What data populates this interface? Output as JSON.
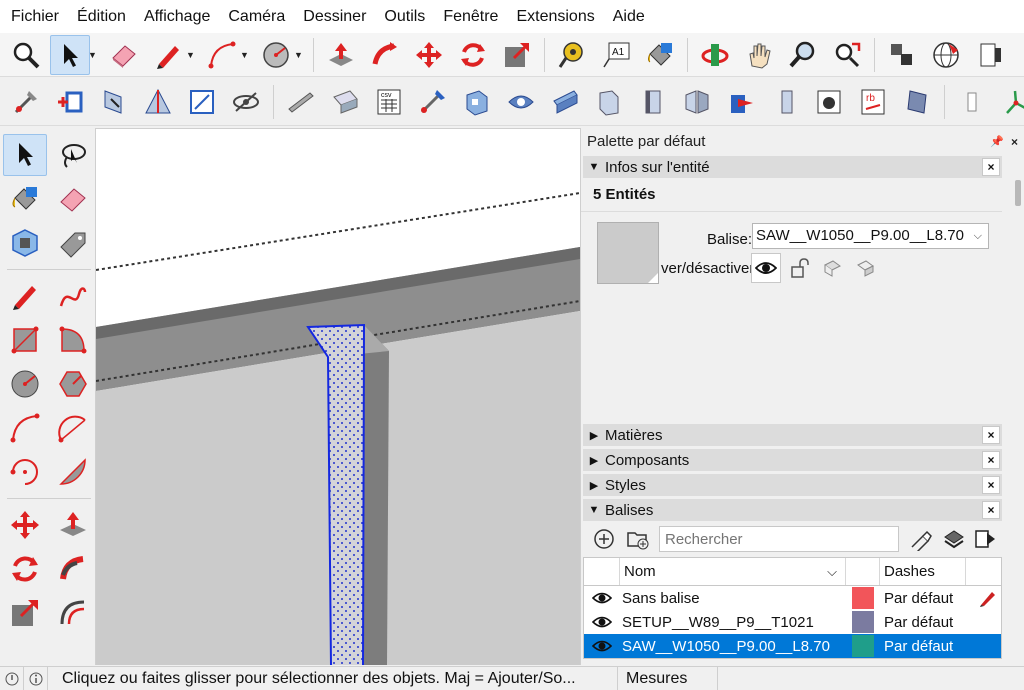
{
  "menu": [
    "Fichier",
    "Édition",
    "Affichage",
    "Caméra",
    "Dessiner",
    "Outils",
    "Fenêtre",
    "Extensions",
    "Aide"
  ],
  "toolbar1": {
    "buttons": [
      "zoom-icon",
      "select-icon",
      "eraser-icon",
      "pencil-icon",
      "arc-icon",
      "circle-icon",
      "push-pull-icon",
      "follow-me-icon",
      "move-icon",
      "rotate-icon",
      "scale-icon",
      "tape-measure-icon",
      "text-icon",
      "paint-bucket-icon",
      "orbit-icon",
      "pan-icon",
      "zoom-window-icon",
      "zoom-extents-icon",
      "components-icon",
      "geo-location-icon",
      "warehouse-icon"
    ],
    "text_tool_label": "A1"
  },
  "toolbar2": {
    "buttons": [
      "extension-tool-1",
      "extension-tool-2",
      "extension-tool-3",
      "extension-tool-4",
      "extension-tool-5",
      "extension-tool-6",
      "extension-tool-7",
      "extension-tool-8",
      "csv-export-icon",
      "extension-tool-10",
      "extension-tool-11",
      "extension-tool-12",
      "extension-tool-13",
      "extension-tool-14",
      "extension-tool-15",
      "extension-tool-16",
      "extension-tool-17",
      "extension-tool-18",
      "extension-tool-19",
      "rb-tool-icon",
      "extension-tool-21",
      "extension-tool-22",
      "extension-tool-23",
      "extension-tool-24"
    ],
    "csv_label": "csv",
    "rb_label": "rb"
  },
  "palette": {
    "title": "Palette par défaut",
    "entity_info": {
      "heading": "Infos sur l'entité",
      "count": "5 Entités",
      "tag_label": "Balise:",
      "tag_value": "SAW__W1050__P9.00__L8.70",
      "toggle_label": "ver/désactiver"
    },
    "panels": [
      "Matières",
      "Composants",
      "Styles"
    ],
    "tags": {
      "heading": "Balises",
      "search_placeholder": "Rechercher",
      "col_name": "Nom",
      "col_dashes": "Dashes",
      "rows": [
        {
          "name": "Sans balise",
          "color": "#f2555a",
          "dashes": "Par défaut",
          "selected": false
        },
        {
          "name": "SETUP__W89__P9__T1021",
          "color": "#7b7ba0",
          "dashes": "Par défaut",
          "selected": false
        },
        {
          "name": "SAW__W1050__P9.00__L8.70",
          "color": "#1f9e8a",
          "dashes": "Par défaut",
          "selected": true
        }
      ]
    }
  },
  "status": {
    "text": "Cliquez ou faites glisser pour sélectionner des objets. Maj = Ajouter/So...",
    "measures_label": "Mesures"
  }
}
